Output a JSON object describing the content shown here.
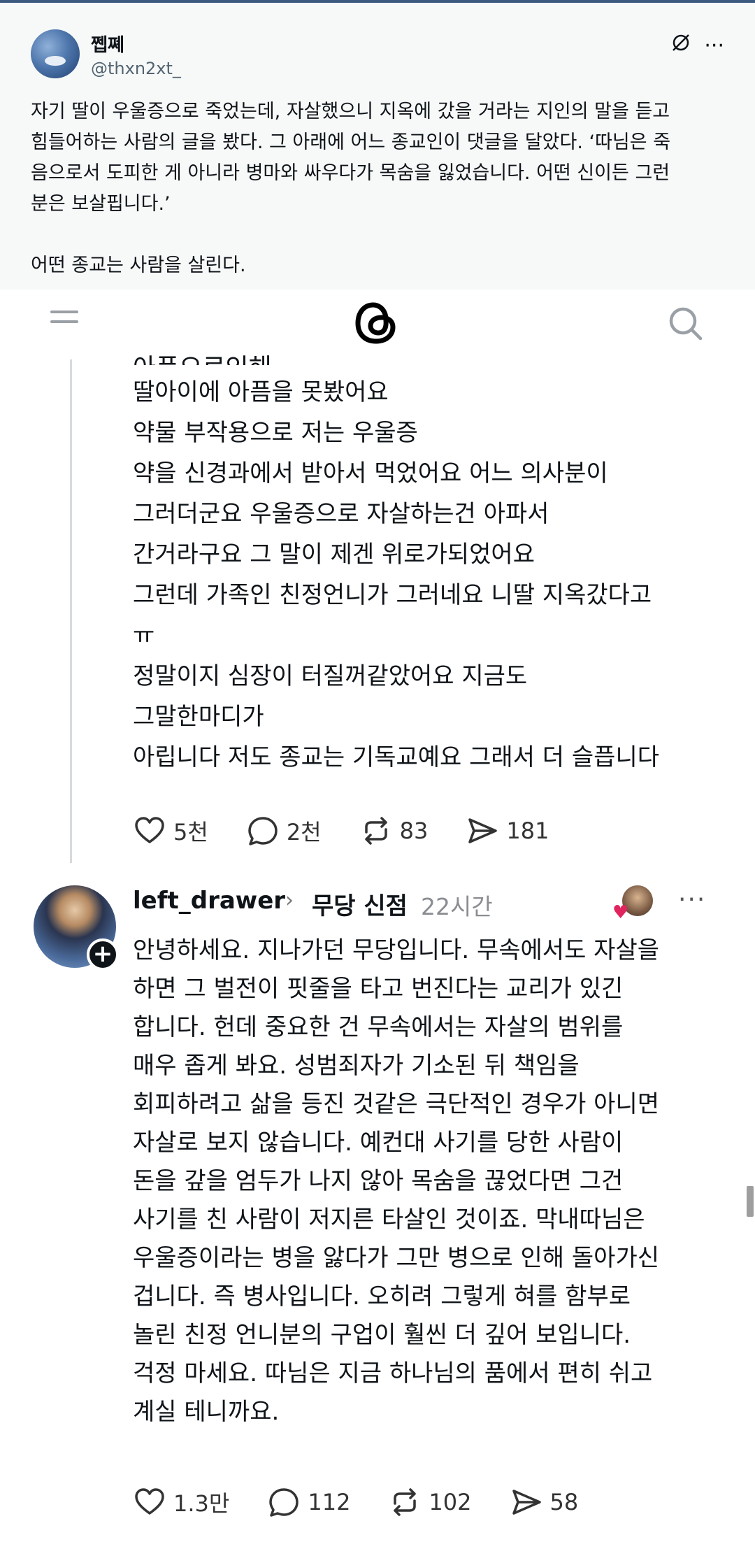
{
  "post": {
    "author_name": "쩹쪠",
    "author_handle": "@thxn2xt_",
    "text": "자기 딸이 우울증으로 죽었는데, 자살했으니 지옥에 갔을 거라는 지인의 말을 듣고\n힘들어하는 사람의 글을 봤다. 그 아래에 어느 종교인이 댓글을 달았다. ‘따님은 죽\n음으로서 도피한 게 아니라 병마와 싸우다가 목숨을 잃었습니다. 어떤 신이든 그런\n분은 보살핍니다.’\n\n어떤 종교는 사람을 살린다."
  },
  "embedded": {
    "cut_line": "아픔으로인해",
    "reply_lines": [
      "딸아이에 아픔을 못봤어요",
      "약물 부작용으로 저는 우울증",
      "약을 신경과에서 받아서 먹었어요 어느 의사분이",
      "그러더군요 우울증으로 자살하는건 아파서",
      "간거라구요 그 말이 제겐 위로가되었어요",
      "그런데 가족인 친정언니가 그러네요 니딸 지옥갔다고",
      "ㅠ",
      "정말이지 심장이 터질꺼같았어요 지금도",
      "그말한마디가",
      "아립니다 저도 종교는 기독교예요 그래서 더 슬픕니다"
    ],
    "reply_actions": {
      "likes": "5천",
      "comments": "2천",
      "reposts": "83",
      "shares": "181"
    },
    "comment": {
      "username": "left_drawer",
      "topic": "무당 신점",
      "time": "22시간",
      "lines": [
        "안녕하세요. 지나가던 무당입니다. 무속에서도 자살을",
        "하면 그 벌전이 핏줄을 타고 번진다는 교리가 있긴",
        "합니다. 헌데 중요한 건 무속에서는 자살의 범위를",
        "매우 좁게 봐요. 성범죄자가 기소된 뒤 책임을",
        "회피하려고 삶을 등진 것같은 극단적인 경우가 아니면",
        "자살로 보지 않습니다. 예컨대 사기를 당한 사람이",
        "돈을 갚을 엄두가 나지 않아 목숨을 끊었다면 그건",
        "사기를 친 사람이 저지른 타살인 것이죠. 막내따님은",
        "우울증이라는 병을 앓다가 그만 병으로 인해 돌아가신",
        "겁니다. 즉 병사입니다. 오히려 그렇게 혀를 함부로",
        "놀린 친정 언니분의 구업이 훨씬 더 깊어 보입니다.",
        "걱정 마세요. 따님은 지금 하나님의 품에서 편히 쉬고",
        "계실 테니까요."
      ],
      "actions": {
        "likes": "1.3만",
        "comments": "112",
        "reposts": "102",
        "shares": "58"
      }
    }
  },
  "icons": {
    "menu": "menu-icon",
    "threads_logo": "threads-logo-icon",
    "search": "search-icon",
    "heart": "heart-icon",
    "comment": "comment-icon",
    "repost": "repost-icon",
    "share": "share-icon"
  }
}
